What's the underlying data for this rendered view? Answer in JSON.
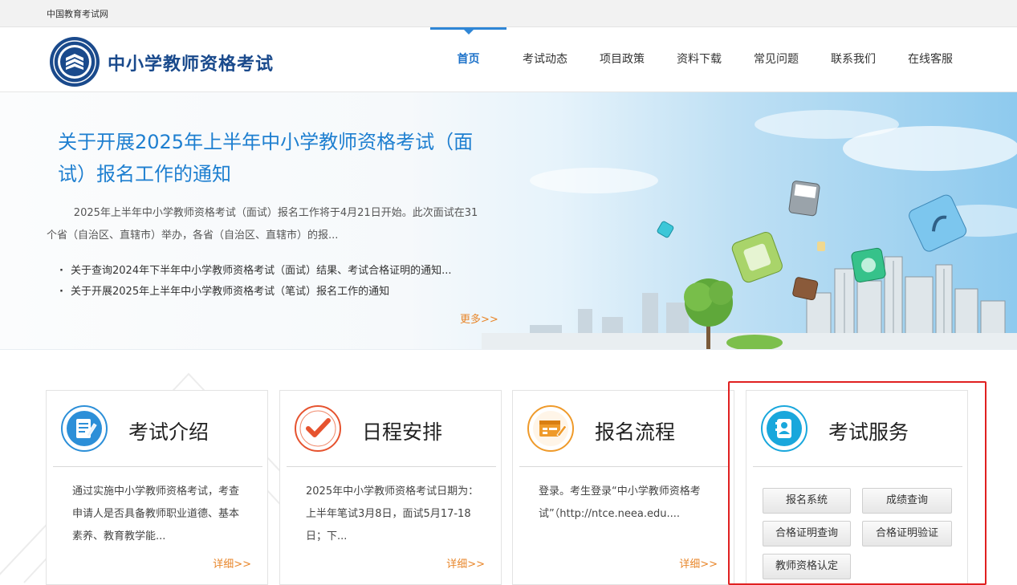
{
  "topbar": {
    "site_link": "中国教育考试网"
  },
  "header": {
    "logo_title": "中小学教师资格考试",
    "nav": [
      {
        "label": "首页",
        "active": true
      },
      {
        "label": "考试动态",
        "active": false
      },
      {
        "label": "项目政策",
        "active": false
      },
      {
        "label": "资料下载",
        "active": false
      },
      {
        "label": "常见问题",
        "active": false
      },
      {
        "label": "联系我们",
        "active": false
      },
      {
        "label": "在线客服",
        "active": false
      }
    ]
  },
  "banner": {
    "headline": "关于开展2025年上半年中小学教师资格考试（面试）报名工作的通知",
    "summary": "2025年上半年中小学教师资格考试（面试）报名工作将于4月21日开始。此次面试在31个省（自治区、直辖市）举办，各省（自治区、直辖市）的报...",
    "news": [
      "关于查询2024年下半年中小学教师资格考试（面试）结果、考试合格证明的通知...",
      "关于开展2025年上半年中小学教师资格考试（笔试）报名工作的通知"
    ],
    "more_label": "更多>>"
  },
  "cards": [
    {
      "title": "考试介绍",
      "icon": "document-edit-icon",
      "accent": "#2c8fd8",
      "text": "通过实施中小学教师资格考试，考查申请人是否具备教师职业道德、基本素养、教育教学能...",
      "more": "详细>>"
    },
    {
      "title": "日程安排",
      "icon": "checkmark-icon",
      "accent": "#e6532f",
      "text": "2025年中小学教师资格考试日期为：上半年笔试3月8日，面试5月17-18日；下...",
      "more": "详细>>"
    },
    {
      "title": "报名流程",
      "icon": "registration-form-icon",
      "accent": "#ef9a2a",
      "text": "登录。考生登录“中小学教师资格考试”（http://ntce.neea.edu....",
      "more": "详细>>"
    }
  ],
  "services": {
    "title": "考试服务",
    "icon": "contact-book-icon",
    "accent": "#19a7dc",
    "buttons": [
      "报名系统",
      "成绩查询",
      "合格证明查询",
      "合格证明验证",
      "教师资格认定"
    ]
  },
  "colors": {
    "brand_blue": "#1a4a8c",
    "link_blue": "#1e7fd0",
    "more_orange": "#e8862a",
    "highlight_red": "#e02020"
  }
}
